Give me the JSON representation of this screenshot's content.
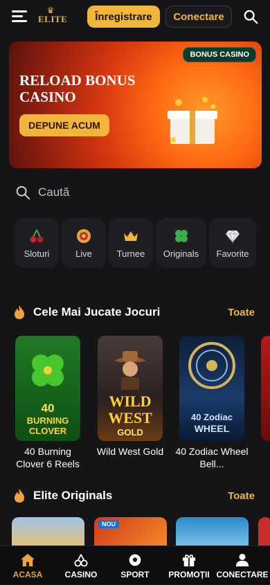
{
  "header": {
    "logo_text": "ELITE",
    "register_label": "Înregistrare",
    "login_label": "Conectare"
  },
  "banner": {
    "badge": "BONUS CASINO",
    "title": "RELOAD BONUS CASINO",
    "cta": "DEPUNE ACUM"
  },
  "search": {
    "placeholder": "Caută"
  },
  "categories": [
    {
      "label": "Sloturi",
      "icon": "cherry-icon"
    },
    {
      "label": "Live",
      "icon": "roulette-icon"
    },
    {
      "label": "Turnee",
      "icon": "crown-icon"
    },
    {
      "label": "Originals",
      "icon": "clover-icon"
    },
    {
      "label": "Favorite",
      "icon": "diamond-icon"
    }
  ],
  "most_played": {
    "title": "Cele Mai Jucate Jocuri",
    "link": "Toate",
    "games": [
      {
        "name": "40 Burning Clover 6 Reels",
        "art_line1": "40",
        "art_line2": "BURNING",
        "art_line3": "CLOVER"
      },
      {
        "name": "Wild West Gold",
        "art_line1": "WILD",
        "art_line2": "WEST",
        "art_line3": "GOLD"
      },
      {
        "name": "40 Zodiac Wheel Bell...",
        "art_line1": "40 Zodiac",
        "art_line2": "WHEEL"
      }
    ]
  },
  "originals": {
    "title": "Elite Originals",
    "link": "Toate",
    "new_badge": "NOU"
  },
  "bottom_nav": [
    {
      "label": "ACASA",
      "icon": "home-icon",
      "active": true
    },
    {
      "label": "CASINO",
      "icon": "cherry-icon"
    },
    {
      "label": "SPORT",
      "icon": "soccer-ball-icon"
    },
    {
      "label": "PROMOȚII",
      "icon": "gift-icon"
    },
    {
      "label": "CONECTARE",
      "icon": "user-icon"
    }
  ],
  "colors": {
    "accent": "#f2b53c",
    "background": "#151517",
    "chip": "#1f1f23"
  }
}
